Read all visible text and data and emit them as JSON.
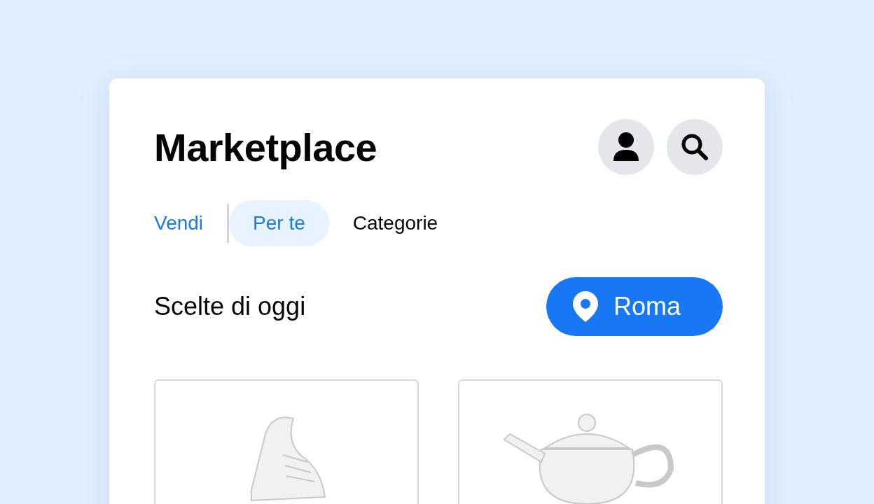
{
  "header": {
    "title": "Marketplace"
  },
  "tabs": [
    {
      "label": "Vendi",
      "kind": "action",
      "selected": false
    },
    {
      "label": "Per te",
      "kind": "tab",
      "selected": true
    },
    {
      "label": "Categorie",
      "kind": "tab",
      "selected": false
    }
  ],
  "section": {
    "title": "Scelte di oggi",
    "location": "Roma"
  },
  "products": [
    {
      "kind": "shoe"
    },
    {
      "kind": "teapot"
    }
  ]
}
